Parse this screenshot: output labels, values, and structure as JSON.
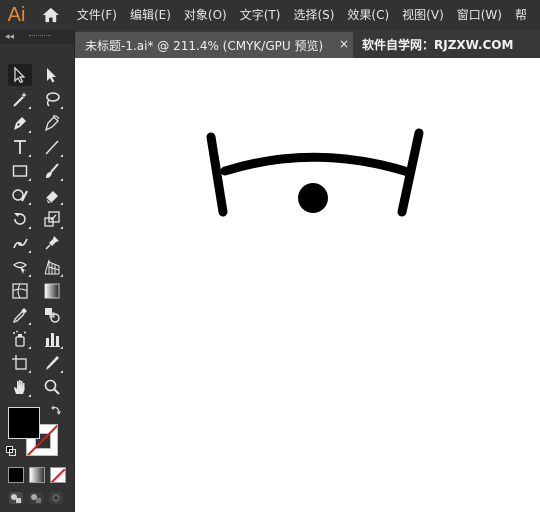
{
  "app": {
    "logo_text": "Ai",
    "brand_color": "#e28a3b"
  },
  "menubar": {
    "items": [
      {
        "label": "文件(F)"
      },
      {
        "label": "编辑(E)"
      },
      {
        "label": "对象(O)"
      },
      {
        "label": "文字(T)"
      },
      {
        "label": "选择(S)"
      },
      {
        "label": "效果(C)"
      },
      {
        "label": "视图(V)"
      },
      {
        "label": "窗口(W)"
      },
      {
        "label": "帮"
      }
    ]
  },
  "toolpanel": {
    "collapse_glyph": "◂◂",
    "tools": [
      {
        "name": "selection-tool",
        "selected": true
      },
      {
        "name": "direct-selection-tool"
      },
      {
        "name": "magic-wand-tool"
      },
      {
        "name": "lasso-tool"
      },
      {
        "name": "pen-tool"
      },
      {
        "name": "curvature-tool"
      },
      {
        "name": "type-tool"
      },
      {
        "name": "line-segment-tool"
      },
      {
        "name": "rectangle-tool"
      },
      {
        "name": "paintbrush-tool"
      },
      {
        "name": "shaper-tool"
      },
      {
        "name": "eraser-tool"
      },
      {
        "name": "rotate-tool"
      },
      {
        "name": "scale-tool"
      },
      {
        "name": "puppet-warp-tool"
      },
      {
        "name": "pin-tool"
      },
      {
        "name": "free-transform-tool"
      },
      {
        "name": "perspective-grid-tool"
      },
      {
        "name": "mesh-tool"
      },
      {
        "name": "gradient-tool"
      },
      {
        "name": "eyedropper-tool"
      },
      {
        "name": "blend-tool"
      },
      {
        "name": "symbol-sprayer-tool"
      },
      {
        "name": "column-graph-tool"
      },
      {
        "name": "artboard-tool"
      },
      {
        "name": "slice-tool"
      },
      {
        "name": "hand-tool"
      },
      {
        "name": "zoom-tool"
      }
    ],
    "fill_color": "#000000",
    "stroke_color": "none"
  },
  "tabs": [
    {
      "title": "未标题-1.ai* @ 211.4% (CMYK/GPU 预览)",
      "close_glyph": "×",
      "active": true
    }
  ],
  "watermark": "软件自学网：RJZXW.COM",
  "canvas": {
    "background": "#ffffff",
    "artwork_color": "#000000"
  }
}
